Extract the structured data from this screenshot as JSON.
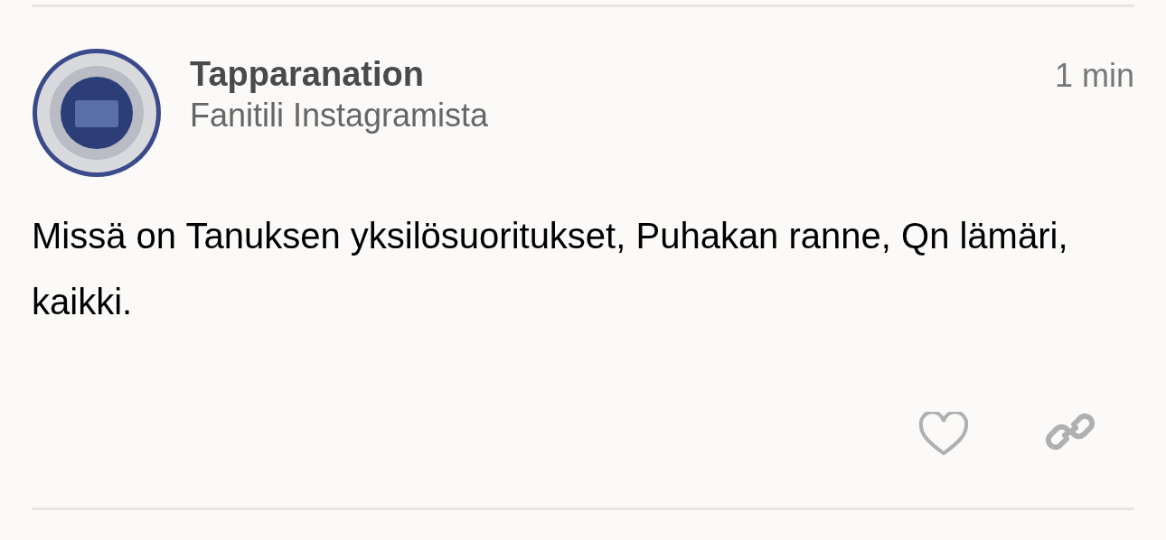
{
  "post": {
    "author": "Tapparanation",
    "subtitle": "Fanitili Instagramista",
    "time": "1 min",
    "text": "Missä on Tanuksen yksilösuoritukset, Puhakan ranne, Qn lämäri, kaikki.",
    "liked": false
  }
}
